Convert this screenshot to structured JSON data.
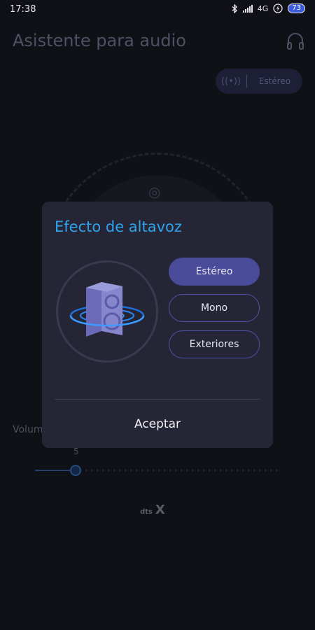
{
  "status_bar": {
    "time": "17:38",
    "network": "4G",
    "battery": "73",
    "icons": [
      "bluetooth-icon",
      "signal-icon",
      "charging-icon",
      "battery-icon"
    ]
  },
  "app": {
    "title": "Asistente para audio",
    "mode_pill": {
      "label": "Estéreo",
      "icon": "surround-wave-icon"
    },
    "volume": {
      "label": "Volume",
      "value": "5",
      "level": 5
    },
    "brand": {
      "text": "dts",
      "sub": "X"
    }
  },
  "dialog": {
    "title": "Efecto de altavoz",
    "options": [
      {
        "label": "Estéreo",
        "selected": true
      },
      {
        "label": "Mono",
        "selected": false
      },
      {
        "label": "Exteriores",
        "selected": false
      }
    ],
    "accept_label": "Aceptar"
  },
  "colors": {
    "accent": "#2fa3ec",
    "selected_option": "#4b4b9c",
    "dialog_bg": "#252535",
    "page_bg": "#101117"
  }
}
